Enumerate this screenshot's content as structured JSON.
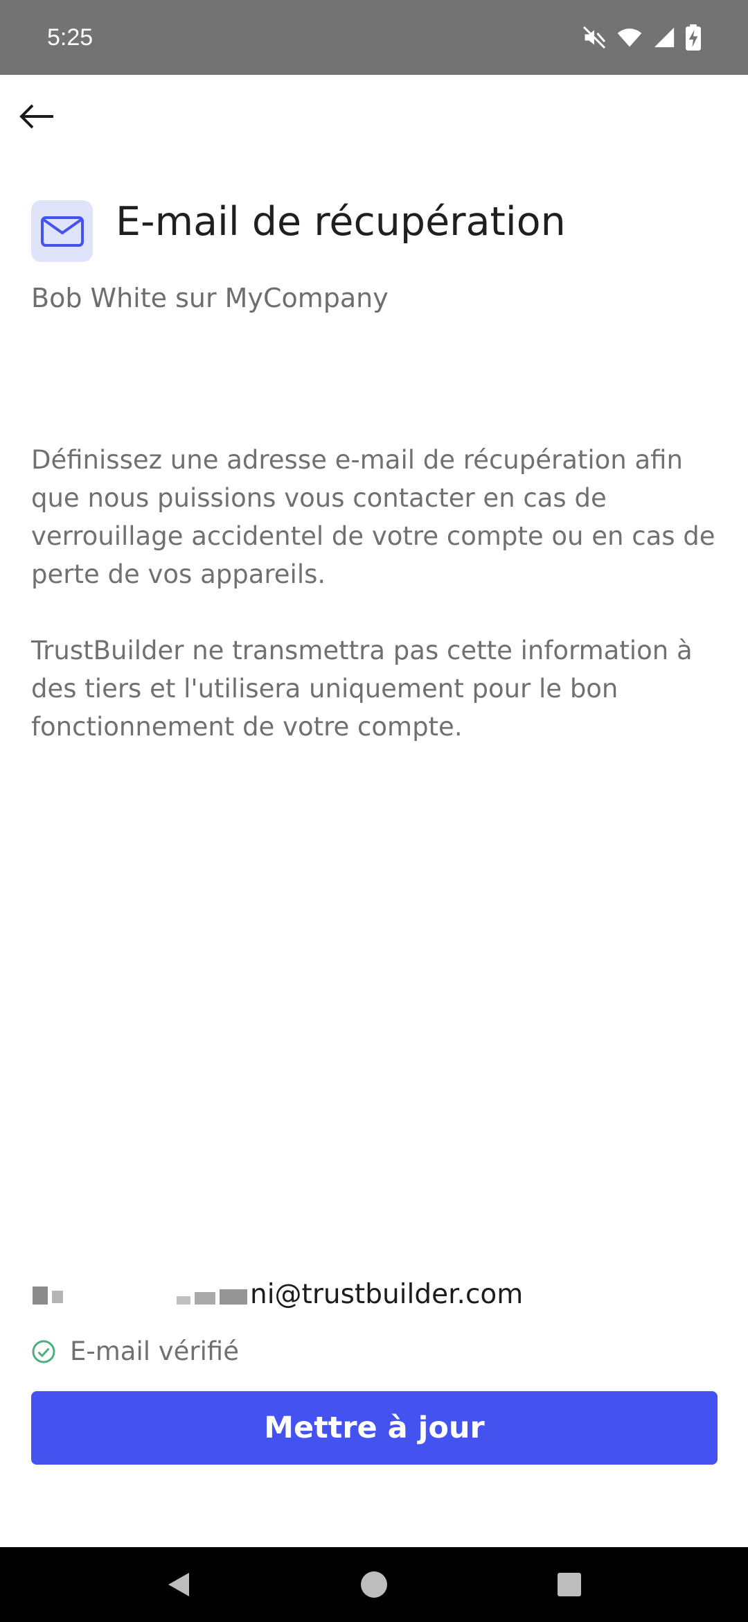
{
  "status_bar": {
    "time": "5:25",
    "icons": [
      "mute-icon",
      "wifi-icon",
      "signal-icon",
      "battery-charging-icon"
    ]
  },
  "app_bar": {
    "back_icon": "arrow-left-icon"
  },
  "header": {
    "icon": "mail-icon",
    "title": "E-mail de récupération",
    "subtitle": "Bob White sur MyCompany"
  },
  "description": {
    "paragraph_1": "Définissez une adresse e-mail de récupération afin que nous puissions vous contacter en cas de verrouillage accidentel de votre compte ou en cas de perte de vos appareils.",
    "paragraph_2": "TrustBuilder ne transmettra pas cette information à des tiers et l'utilisera uniquement pour le bon fonctionnement de votre compte."
  },
  "email": {
    "visible_part": "ni@trustbuilder.com",
    "verified_label": "E-mail vérifié"
  },
  "actions": {
    "update_label": "Mettre à jour"
  },
  "colors": {
    "primary": "#4452f0",
    "icon_bg": "#dfe4fb",
    "icon_fg": "#4452f0",
    "verified": "#4caf7d",
    "status_bar": "#737373"
  }
}
